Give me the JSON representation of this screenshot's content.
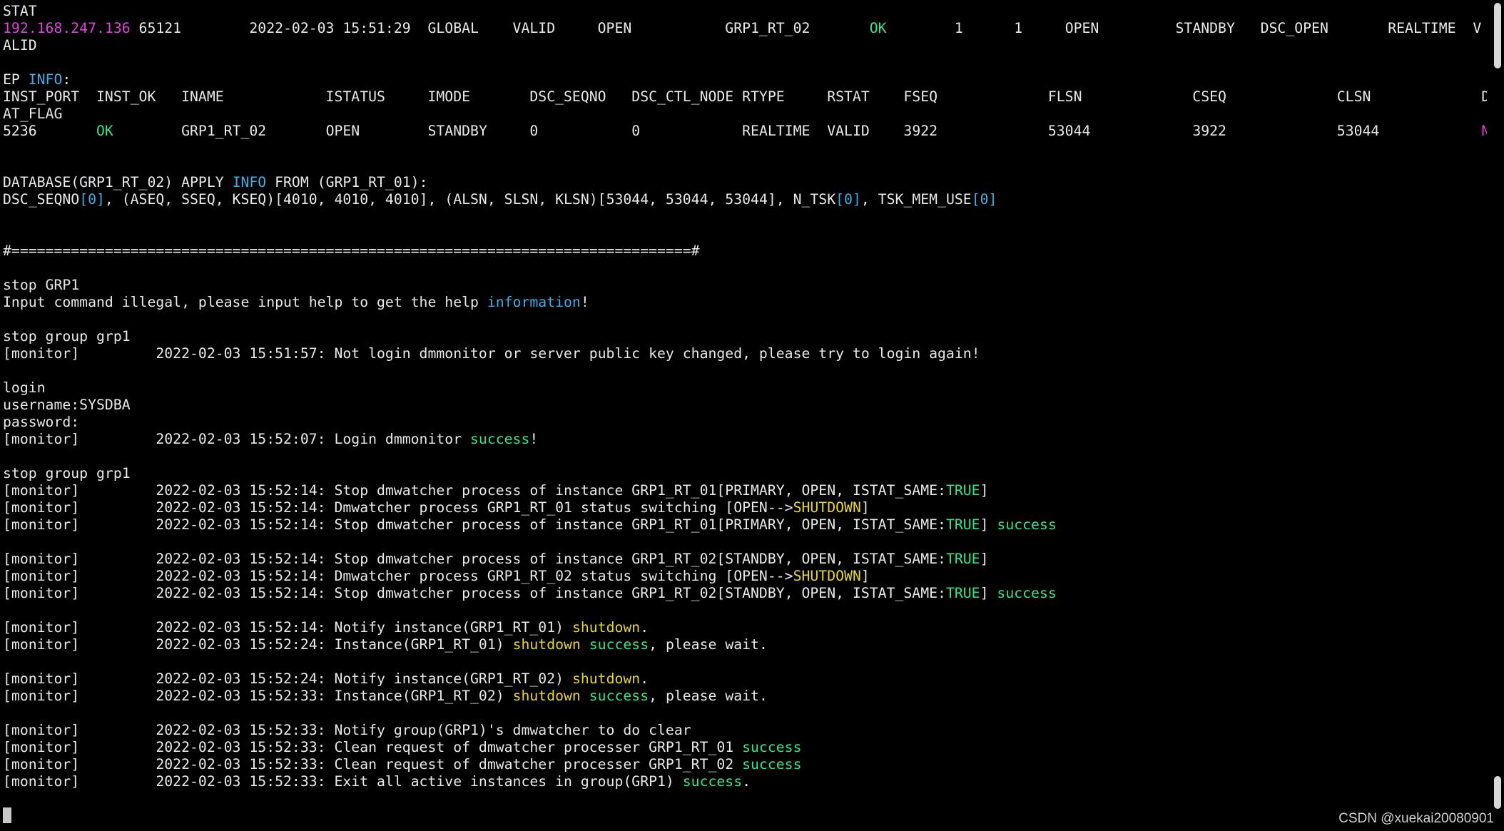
{
  "colors": {
    "background": "#000000",
    "default": "#e8e8e8",
    "magenta": "#e040e0",
    "green": "#2ee68a",
    "yellow": "#e8d62a",
    "cyan": "#3ab0e8"
  },
  "terminal": {
    "lines": [
      [
        {
          "t": "STAT",
          "c": "default"
        }
      ],
      [
        {
          "t": "192.168.247.136",
          "c": "magenta"
        },
        {
          "t": " 65121        2022-02-03 15:51:29  GLOBAL    VALID     OPEN           GRP1_RT_02       ",
          "c": "default"
        },
        {
          "t": "OK",
          "c": "green"
        },
        {
          "t": "        1      1     OPEN         STANDBY   DSC_OPEN       REALTIME  V",
          "c": "default"
        }
      ],
      [
        {
          "t": "ALID",
          "c": "default"
        }
      ],
      [],
      [
        {
          "t": "EP ",
          "c": "default"
        },
        {
          "t": "INFO",
          "c": "cyan"
        },
        {
          "t": ":",
          "c": "default"
        }
      ],
      [
        {
          "t": "INST_PORT  INST_OK   INAME            ISTATUS     IMODE       DSC_SEQNO   DSC_CTL_NODE RTYPE     RSTAT    FSEQ             FLSN             CSEQ             CLSN             DW_ST",
          "c": "default"
        }
      ],
      [
        {
          "t": "AT_FLAG",
          "c": "default"
        }
      ],
      [
        {
          "t": "5236       ",
          "c": "default"
        },
        {
          "t": "OK",
          "c": "green"
        },
        {
          "t": "        GRP1_RT_02       OPEN        STANDBY     0           0            REALTIME  VALID    3922             53044            3922             53044            ",
          "c": "default"
        },
        {
          "t": "NONE",
          "c": "magenta"
        }
      ],
      [],
      [],
      [
        {
          "t": "DATABASE(GRP1_RT_02) APPLY ",
          "c": "default"
        },
        {
          "t": "INFO",
          "c": "cyan"
        },
        {
          "t": " FROM (GRP1_RT_01):",
          "c": "default"
        }
      ],
      [
        {
          "t": "DSC_SEQNO",
          "c": "default"
        },
        {
          "t": "[0]",
          "c": "cyan"
        },
        {
          "t": ", (ASEQ, SSEQ, KSEQ)[4010, 4010, 4010], (ALSN, SLSN, KLSN)[53044, 53044, 53044], N_TSK",
          "c": "default"
        },
        {
          "t": "[0]",
          "c": "cyan"
        },
        {
          "t": ", TSK_MEM_USE",
          "c": "default"
        },
        {
          "t": "[0]",
          "c": "cyan"
        }
      ],
      [],
      [],
      [
        {
          "t": "#================================================================================#",
          "c": "default"
        }
      ],
      [],
      [
        {
          "t": "stop GRP1",
          "c": "default"
        }
      ],
      [
        {
          "t": "Input command illegal, please input help to get the help ",
          "c": "default"
        },
        {
          "t": "information",
          "c": "cyan"
        },
        {
          "t": "!",
          "c": "default"
        }
      ],
      [],
      [
        {
          "t": "stop group grp1",
          "c": "default"
        }
      ],
      [
        {
          "t": "[monitor]         2022-02-03 15:51:57: Not login dmmonitor or server public key changed, please try to login again!",
          "c": "default"
        }
      ],
      [],
      [
        {
          "t": "login",
          "c": "default"
        }
      ],
      [
        {
          "t": "username:SYSDBA",
          "c": "default"
        }
      ],
      [
        {
          "t": "password:",
          "c": "default"
        }
      ],
      [
        {
          "t": "[monitor]         2022-02-03 15:52:07: Login dmmonitor ",
          "c": "default"
        },
        {
          "t": "success",
          "c": "green"
        },
        {
          "t": "!",
          "c": "default"
        }
      ],
      [],
      [
        {
          "t": "stop group grp1",
          "c": "default"
        }
      ],
      [
        {
          "t": "[monitor]         2022-02-03 15:52:14: Stop dmwatcher process of instance GRP1_RT_01[PRIMARY, OPEN, ISTAT_SAME:",
          "c": "default"
        },
        {
          "t": "TRUE",
          "c": "green"
        },
        {
          "t": "]",
          "c": "default"
        }
      ],
      [
        {
          "t": "[monitor]         2022-02-03 15:52:14: Dmwatcher process GRP1_RT_01 status switching [OPEN-->",
          "c": "default"
        },
        {
          "t": "SHUTDOWN",
          "c": "yellow"
        },
        {
          "t": "]",
          "c": "default"
        }
      ],
      [
        {
          "t": "[monitor]         2022-02-03 15:52:14: Stop dmwatcher process of instance GRP1_RT_01[PRIMARY, OPEN, ISTAT_SAME:",
          "c": "default"
        },
        {
          "t": "TRUE",
          "c": "green"
        },
        {
          "t": "] ",
          "c": "default"
        },
        {
          "t": "success",
          "c": "green"
        }
      ],
      [],
      [
        {
          "t": "[monitor]         2022-02-03 15:52:14: Stop dmwatcher process of instance GRP1_RT_02[STANDBY, OPEN, ISTAT_SAME:",
          "c": "default"
        },
        {
          "t": "TRUE",
          "c": "green"
        },
        {
          "t": "]",
          "c": "default"
        }
      ],
      [
        {
          "t": "[monitor]         2022-02-03 15:52:14: Dmwatcher process GRP1_RT_02 status switching [OPEN-->",
          "c": "default"
        },
        {
          "t": "SHUTDOWN",
          "c": "yellow"
        },
        {
          "t": "]",
          "c": "default"
        }
      ],
      [
        {
          "t": "[monitor]         2022-02-03 15:52:14: Stop dmwatcher process of instance GRP1_RT_02[STANDBY, OPEN, ISTAT_SAME:",
          "c": "default"
        },
        {
          "t": "TRUE",
          "c": "green"
        },
        {
          "t": "] ",
          "c": "default"
        },
        {
          "t": "success",
          "c": "green"
        }
      ],
      [],
      [
        {
          "t": "[monitor]         2022-02-03 15:52:14: Notify instance(GRP1_RT_01) ",
          "c": "default"
        },
        {
          "t": "shutdown",
          "c": "yellow"
        },
        {
          "t": ".",
          "c": "default"
        }
      ],
      [
        {
          "t": "[monitor]         2022-02-03 15:52:24: Instance(GRP1_RT_01) ",
          "c": "default"
        },
        {
          "t": "shutdown",
          "c": "yellow"
        },
        {
          "t": " ",
          "c": "default"
        },
        {
          "t": "success",
          "c": "green"
        },
        {
          "t": ", please wait.",
          "c": "default"
        }
      ],
      [],
      [
        {
          "t": "[monitor]         2022-02-03 15:52:24: Notify instance(GRP1_RT_02) ",
          "c": "default"
        },
        {
          "t": "shutdown",
          "c": "yellow"
        },
        {
          "t": ".",
          "c": "default"
        }
      ],
      [
        {
          "t": "[monitor]         2022-02-03 15:52:33: Instance(GRP1_RT_02) ",
          "c": "default"
        },
        {
          "t": "shutdown",
          "c": "yellow"
        },
        {
          "t": " ",
          "c": "default"
        },
        {
          "t": "success",
          "c": "green"
        },
        {
          "t": ", please wait.",
          "c": "default"
        }
      ],
      [],
      [
        {
          "t": "[monitor]         2022-02-03 15:52:33: Notify group(GRP1)'s dmwatcher to do clear",
          "c": "default"
        }
      ],
      [
        {
          "t": "[monitor]         2022-02-03 15:52:33: Clean request of dmwatcher processer GRP1_RT_01 ",
          "c": "default"
        },
        {
          "t": "success",
          "c": "green"
        }
      ],
      [
        {
          "t": "[monitor]         2022-02-03 15:52:33: Clean request of dmwatcher processer GRP1_RT_02 ",
          "c": "default"
        },
        {
          "t": "success",
          "c": "green"
        }
      ],
      [
        {
          "t": "[monitor]         2022-02-03 15:52:33: Exit all active instances in group(GRP1) ",
          "c": "default"
        },
        {
          "t": "success",
          "c": "green"
        },
        {
          "t": ".",
          "c": "default"
        }
      ],
      [],
      []
    ]
  },
  "watermark": {
    "text": "CSDN @xuekai20080901"
  }
}
